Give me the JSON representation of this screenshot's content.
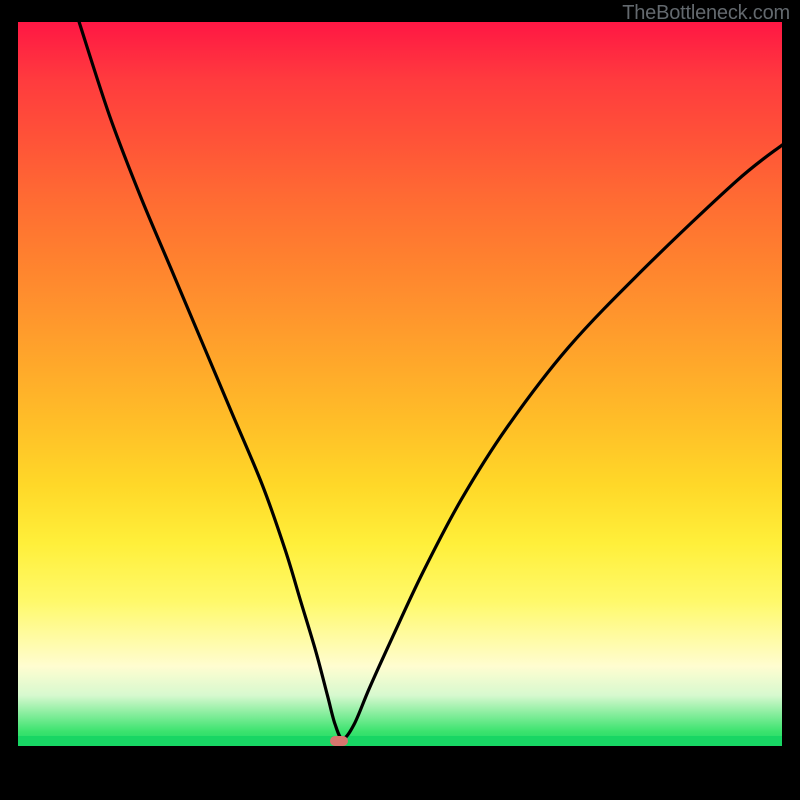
{
  "watermark": {
    "text": "TheBottleneck.com"
  },
  "marker": {
    "x_pct": 42.0,
    "y_pct": 99.3,
    "color": "#d8766f"
  },
  "chart_data": {
    "type": "line",
    "title": "",
    "xlabel": "",
    "ylabel": "",
    "xlim": [
      0,
      100
    ],
    "ylim": [
      0,
      100
    ],
    "series": [
      {
        "name": "bottleneck-curve",
        "x": [
          8,
          12,
          16,
          20,
          24,
          28,
          32,
          35,
          37,
          39,
          40.5,
          41.5,
          42.5,
          44,
          46,
          49,
          53,
          58,
          64,
          72,
          82,
          94,
          100
        ],
        "y": [
          100,
          87,
          76,
          66,
          56,
          46,
          36,
          27,
          20,
          13,
          7,
          3,
          1,
          3,
          8,
          15,
          24,
          34,
          44,
          55,
          66,
          78,
          83
        ]
      }
    ],
    "annotations": [
      {
        "text": "TheBottleneck.com",
        "role": "watermark"
      }
    ],
    "gradient_stops": [
      {
        "pct": 0,
        "color": "#ff1744"
      },
      {
        "pct": 50,
        "color": "#ffb028"
      },
      {
        "pct": 80,
        "color": "#fff96a"
      },
      {
        "pct": 100,
        "color": "#16d864"
      }
    ]
  }
}
